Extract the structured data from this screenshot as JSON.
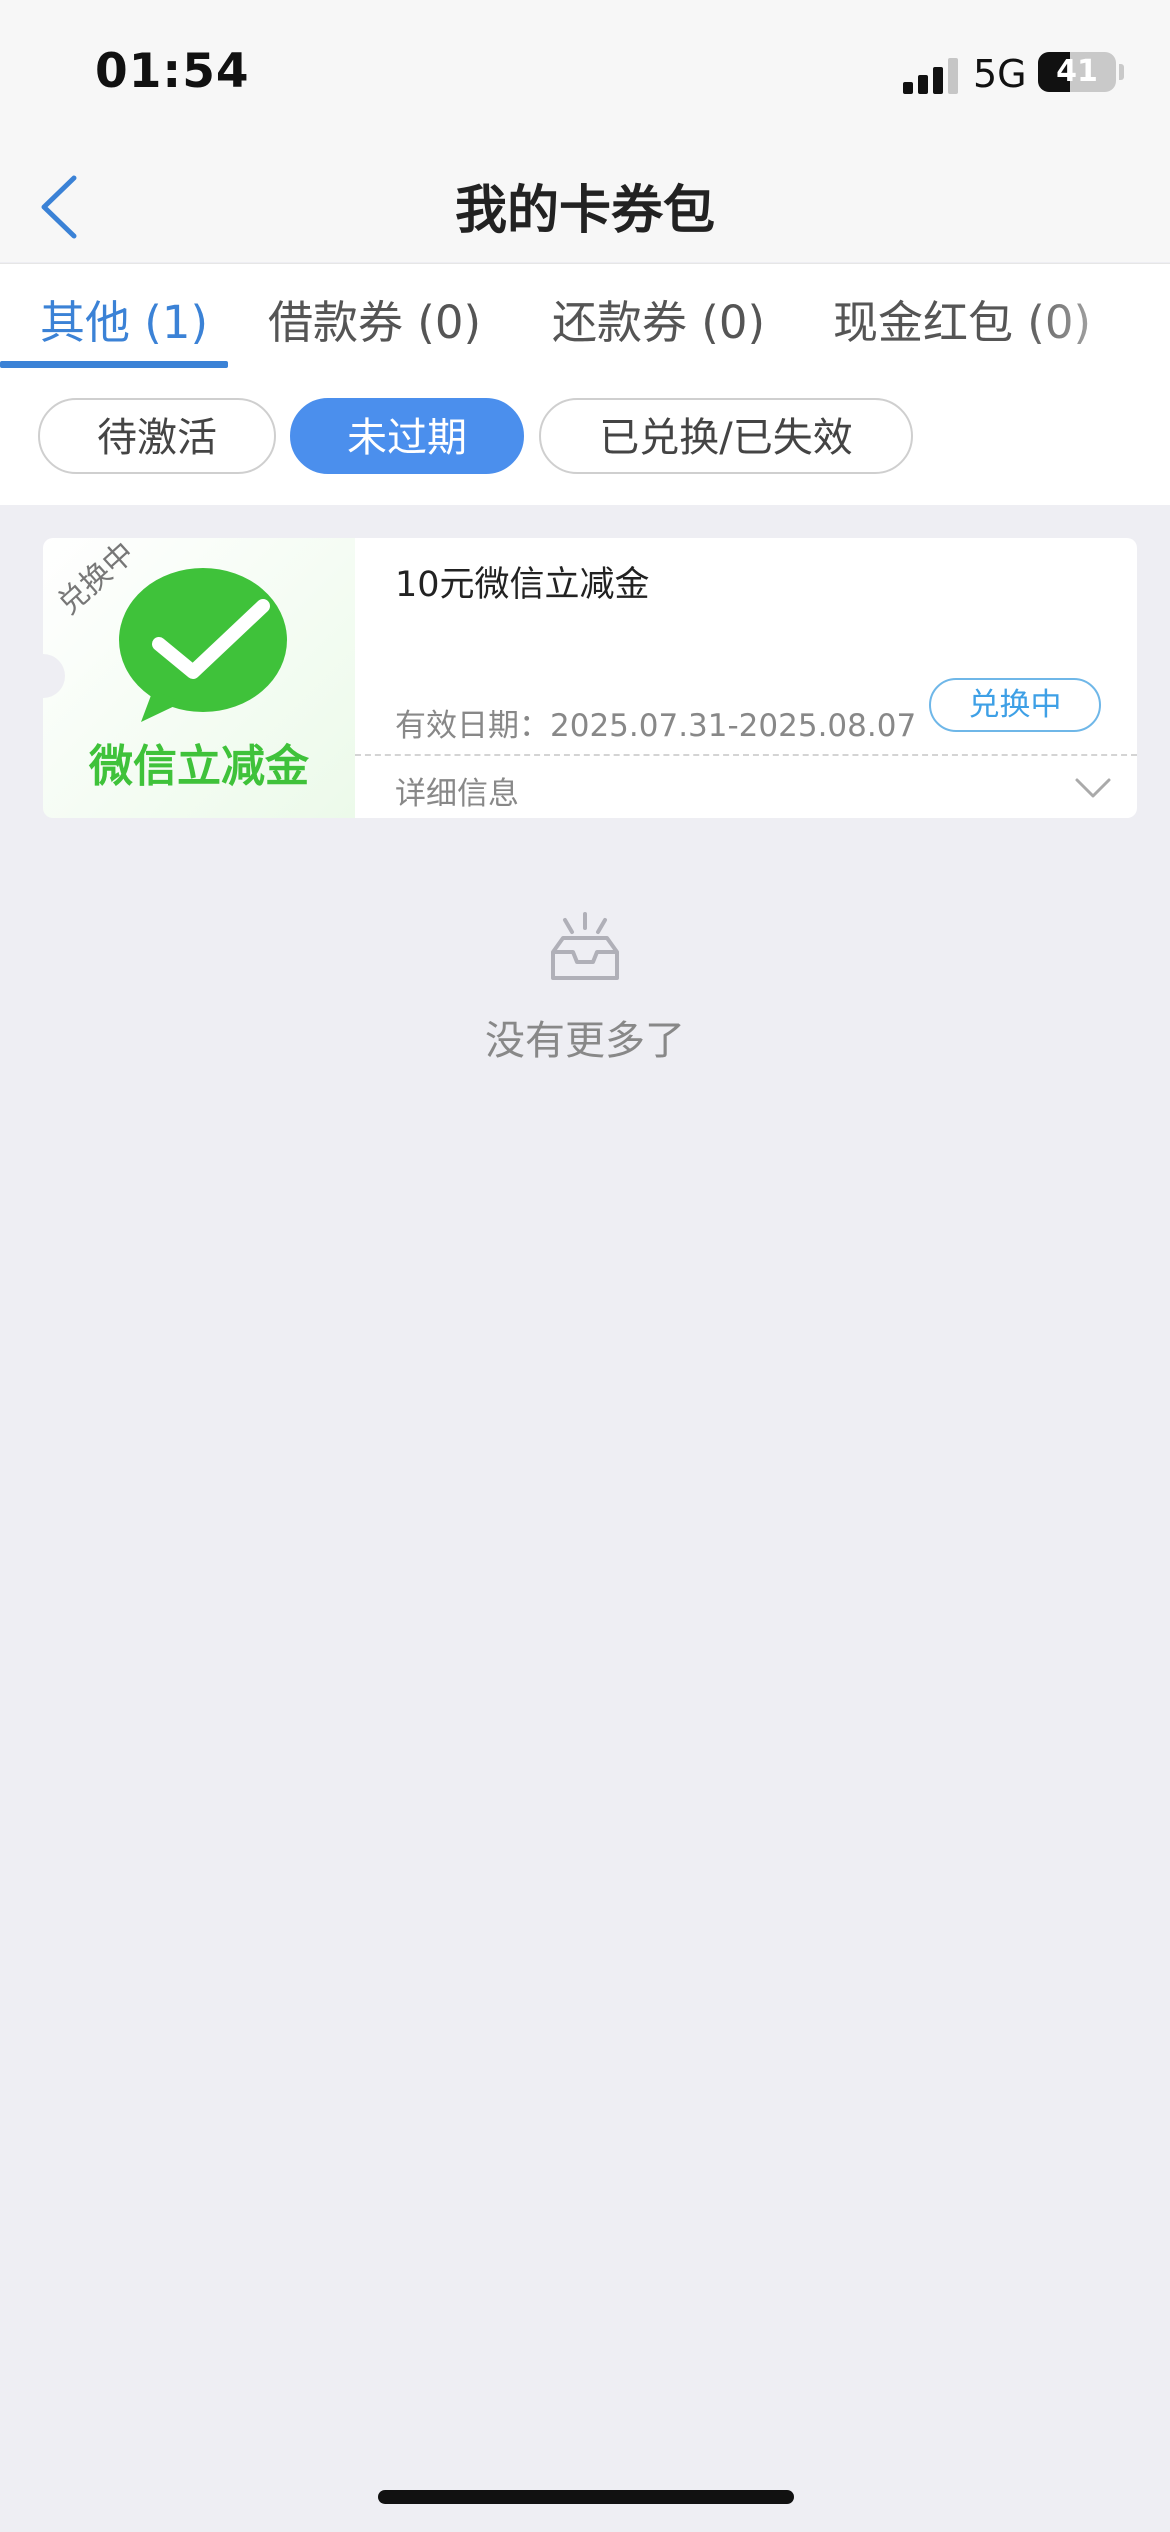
{
  "status_bar": {
    "time": "01:54",
    "network": "5G",
    "battery": "41",
    "battery_level": 0.41
  },
  "nav": {
    "title": "我的卡券包"
  },
  "tabs": [
    {
      "label": "其他 (1)",
      "active": true
    },
    {
      "label": "借款券 (0)",
      "active": false
    },
    {
      "label": "还款券 (0)",
      "active": false
    },
    {
      "label": "现金红包 (0)",
      "active": false
    }
  ],
  "filters": [
    {
      "label": "待激活",
      "active": false
    },
    {
      "label": "未过期",
      "active": true
    },
    {
      "label": "已兑换/已失效",
      "active": false
    }
  ],
  "coupon": {
    "corner_tag": "兑换中",
    "brand": "微信立减金",
    "title": "10元微信立减金",
    "validity": "有效日期：2025.07.31-2025.08.07",
    "status": "兑换中",
    "detail_label": "详细信息"
  },
  "empty_state": {
    "text": "没有更多了"
  },
  "colors": {
    "accent": "#3b82d6",
    "chip_active": "#4b8fed",
    "wechat_green": "#3fc23a",
    "badge_blue": "#3ea0e6"
  }
}
